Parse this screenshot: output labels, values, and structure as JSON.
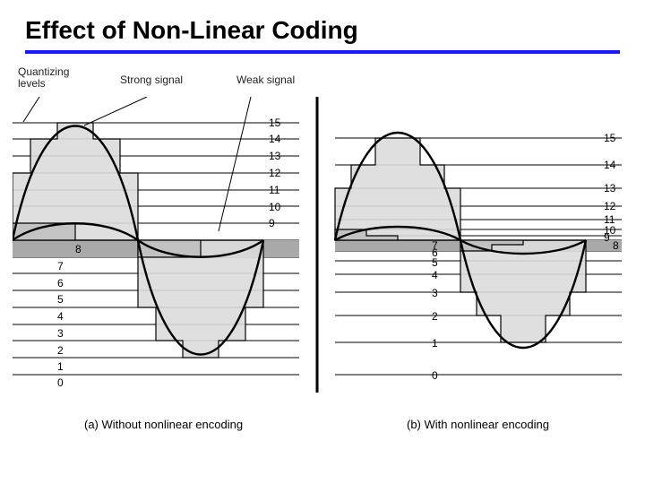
{
  "title": "Effect of Non-Linear Coding",
  "labels": {
    "q": "Quantizing\nlevels",
    "strong": "Strong signal",
    "weak": "Weak signal"
  },
  "captions": {
    "a": "(a) Without nonlinear encoding",
    "b": "(b) With nonlinear encoding"
  },
  "chart_data": [
    {
      "type": "line",
      "title": "Without nonlinear encoding",
      "quant_levels": [
        0,
        1,
        2,
        3,
        4,
        5,
        6,
        7,
        8,
        9,
        10,
        11,
        12,
        13,
        14,
        15
      ],
      "axis_label": "Quantizing level",
      "signals": [
        "Strong signal",
        "Weak signal"
      ],
      "strong": {
        "amplitude_levels": 7.5,
        "mean_level": 8,
        "quant_sequence": [
          8,
          13,
          15,
          15,
          13,
          8,
          3,
          1,
          1,
          3,
          8
        ]
      },
      "weak": {
        "amplitude_levels": 1.0,
        "mean_level": 8,
        "quant_sequence": [
          8,
          9,
          9,
          8,
          7,
          7,
          8
        ]
      },
      "spacing": "uniform"
    },
    {
      "type": "line",
      "title": "With nonlinear encoding",
      "quant_levels": [
        0,
        1,
        2,
        3,
        4,
        5,
        6,
        7,
        8,
        9,
        10,
        11,
        12,
        13,
        14,
        15
      ],
      "axis_label": "Quantizing level",
      "signals": [
        "Strong signal",
        "Weak signal"
      ],
      "strong": {
        "amplitude_levels": 7.5,
        "mean_level": 8,
        "quant_sequence": [
          8,
          13,
          15,
          15,
          13,
          8,
          3,
          1,
          1,
          3,
          8
        ]
      },
      "weak": {
        "amplitude_levels": 1.0,
        "mean_level": 8,
        "quant_sequence": [
          8,
          10,
          10,
          8,
          6,
          6,
          8
        ]
      },
      "spacing": "companded (dense near level 8, sparse at extremes)"
    }
  ]
}
